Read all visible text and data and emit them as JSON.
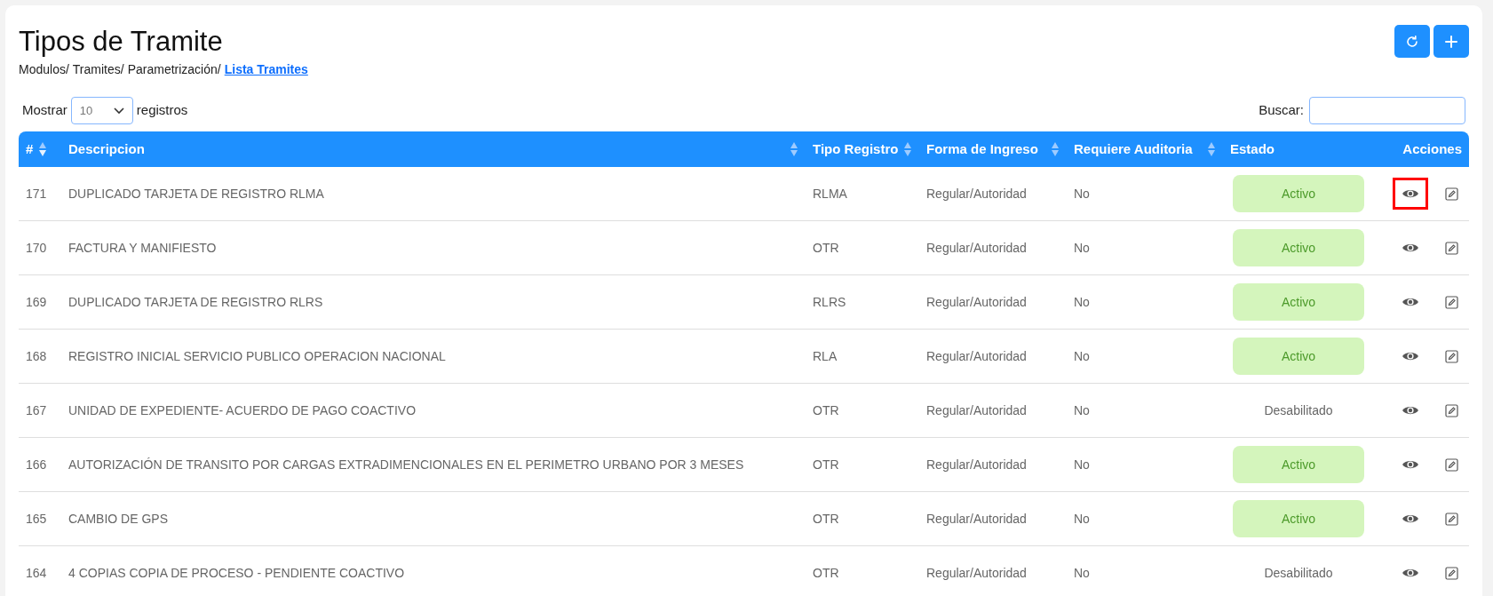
{
  "page": {
    "title": "Tipos de Tramite",
    "breadcrumb": [
      "Modulos/",
      "Tramites/",
      "Parametrización/"
    ],
    "breadcrumb_current": "Lista Tramites"
  },
  "toolbar": {
    "buttons": [
      {
        "kind": "refresh"
      },
      {
        "kind": "add"
      }
    ]
  },
  "length_menu": {
    "label_before": "Mostrar",
    "value": "10",
    "label_after": "registros"
  },
  "search": {
    "label": "Buscar:"
  },
  "table": {
    "columns": [
      {
        "label": "#",
        "sorted": true
      },
      {
        "label": "Descripcion",
        "sorted": false
      },
      {
        "label": "Tipo Registro",
        "sorted": false
      },
      {
        "label": "Forma de Ingreso",
        "sorted": false
      },
      {
        "label": "Requiere Auditoria",
        "sorted": false
      },
      {
        "label": "Estado"
      },
      {
        "label": "Acciones"
      }
    ],
    "rows": [
      {
        "id": "171",
        "descripcion": "DUPLICADO TARJETA DE REGISTRO RLMA",
        "tipo": "RLMA",
        "forma": "Regular/Autoridad",
        "auditoria": "No",
        "estado": "Activo",
        "active": true,
        "highlighted": true
      },
      {
        "id": "170",
        "descripcion": "FACTURA Y MANIFIESTO",
        "tipo": "OTR",
        "forma": "Regular/Autoridad",
        "auditoria": "No",
        "estado": "Activo",
        "active": true,
        "highlighted": false
      },
      {
        "id": "169",
        "descripcion": "DUPLICADO TARJETA DE REGISTRO RLRS",
        "tipo": "RLRS",
        "forma": "Regular/Autoridad",
        "auditoria": "No",
        "estado": "Activo",
        "active": true,
        "highlighted": false
      },
      {
        "id": "168",
        "descripcion": "REGISTRO INICIAL SERVICIO PUBLICO OPERACION NACIONAL",
        "tipo": "RLA",
        "forma": "Regular/Autoridad",
        "auditoria": "No",
        "estado": "Activo",
        "active": true,
        "highlighted": false
      },
      {
        "id": "167",
        "descripcion": "UNIDAD DE EXPEDIENTE- ACUERDO DE PAGO COACTIVO",
        "tipo": "OTR",
        "forma": "Regular/Autoridad",
        "auditoria": "No",
        "estado": "Desabilitado",
        "active": false,
        "highlighted": false
      },
      {
        "id": "166",
        "descripcion": "AUTORIZACIÓN DE TRANSITO POR CARGAS EXTRADIMENCIONALES EN EL PERIMETRO URBANO POR 3 MESES",
        "tipo": "OTR",
        "forma": "Regular/Autoridad",
        "auditoria": "No",
        "estado": "Activo",
        "active": true,
        "highlighted": false
      },
      {
        "id": "165",
        "descripcion": "CAMBIO DE GPS",
        "tipo": "OTR",
        "forma": "Regular/Autoridad",
        "auditoria": "No",
        "estado": "Activo",
        "active": true,
        "highlighted": false
      },
      {
        "id": "164",
        "descripcion": "4 COPIAS COPIA DE PROCESO - PENDIENTE COACTIVO",
        "tipo": "OTR",
        "forma": "Regular/Autoridad",
        "auditoria": "No",
        "estado": "Desabilitado",
        "active": false,
        "highlighted": false
      }
    ]
  }
}
